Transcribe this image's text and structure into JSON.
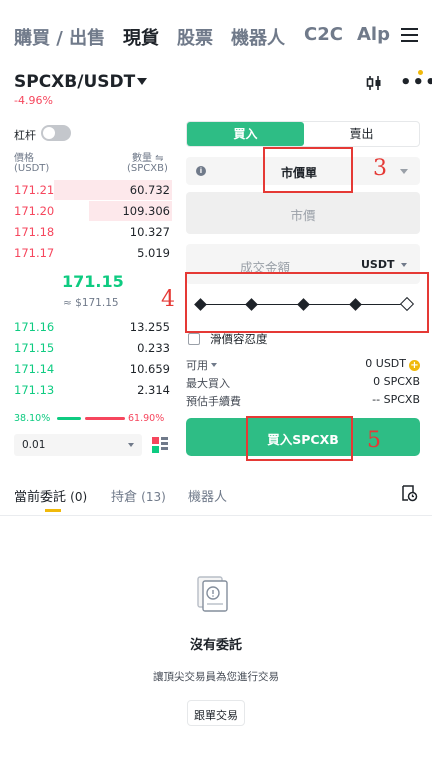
{
  "nav": {
    "items": [
      "購買 / 出售",
      "現貨",
      "股票",
      "機器人",
      "C2C",
      "Alpl"
    ],
    "active_index": 1,
    "menu_icon": "hamburger-menu-icon"
  },
  "pair": {
    "symbol": "SPCXB/USDT",
    "change": "-4.96%",
    "chart_icon": "candlestick-chart-icon",
    "more_icon": "more-dots-icon",
    "more_glyph": "•••"
  },
  "leverage": {
    "label": "杠杆",
    "enabled": false
  },
  "orderbook": {
    "header": {
      "price": "價格",
      "price_unit": "(USDT)",
      "qty": "數量 ⇋",
      "qty_unit": "(SPCXB)"
    },
    "asks": [
      {
        "price": "171.21",
        "qty": "60.732",
        "depth": 1.0
      },
      {
        "price": "171.20",
        "qty": "109.306",
        "depth": 0.7
      },
      {
        "price": "171.18",
        "qty": "10.327",
        "depth": 0.0
      },
      {
        "price": "171.17",
        "qty": "5.019",
        "depth": 0.0
      }
    ],
    "last_price": "171.15",
    "last_price_fiat": "≈ $171.15",
    "bids": [
      {
        "price": "171.16",
        "qty": "13.255",
        "depth": 0.0
      },
      {
        "price": "171.15",
        "qty": "0.233",
        "depth": 0.0
      },
      {
        "price": "171.14",
        "qty": "10.659",
        "depth": 0.0
      },
      {
        "price": "171.13",
        "qty": "2.314",
        "depth": 0.0
      }
    ],
    "buy_ratio": "38.10%",
    "sell_ratio": "61.90%",
    "depth_value": "0.01",
    "view_icon": "orderbook-layout-icon"
  },
  "order_form": {
    "tab_buy": "買入",
    "tab_sell": "賣出",
    "order_type": "市價單",
    "price_placeholder": "市價",
    "amount_placeholder": "成交金額",
    "amount_unit": "USDT",
    "slider_percent": 100,
    "slippage_label": "滑價容忍度",
    "available_label": "可用",
    "available_value": "0 USDT",
    "max_buy_label": "最大買入",
    "max_buy_value": "0 SPCXB",
    "fee_label": "預估手續費",
    "fee_value": "-- SPCXB",
    "submit_label": "買入SPCXB"
  },
  "annotations": {
    "box3": "3",
    "box4": "4",
    "box5": "5",
    "color": "#e53935"
  },
  "bottom_tabs": {
    "open_orders": "當前委託",
    "open_orders_count": "(0)",
    "holdings": "持倉",
    "holdings_count": "(13)",
    "bots": "機器人",
    "history_icon": "order-history-icon"
  },
  "empty_state": {
    "icon": "empty-document-icon",
    "title": "沒有委託",
    "description": "讓頂尖交易員為您進行交易",
    "button": "跟單交易"
  },
  "colors": {
    "buy": "#0ecb81",
    "sell": "#f6465d",
    "accent": "#f0b90b",
    "button": "#2ebd85"
  }
}
